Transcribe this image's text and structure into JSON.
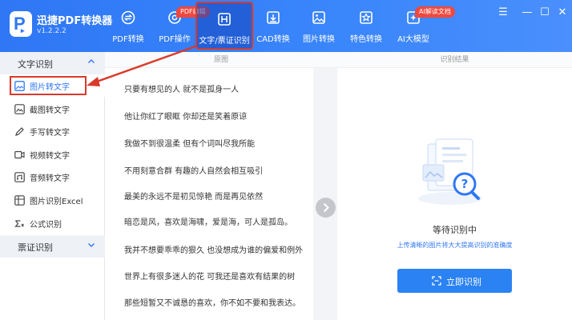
{
  "app": {
    "name": "迅捷PDF转换器",
    "version": "v1.2.2.2"
  },
  "nav": [
    {
      "label": "PDF转换"
    },
    {
      "label": "PDF操作",
      "tag": "PDF编辑"
    },
    {
      "label": "文字/票证识别"
    },
    {
      "label": "CAD转换"
    },
    {
      "label": "图片转换"
    },
    {
      "label": "特色转换"
    },
    {
      "label": "AI大模型",
      "tag": "AI解读文档"
    }
  ],
  "window_controls": {
    "menu": "☰",
    "minimize": "—",
    "maximize": "☐",
    "close": "✕"
  },
  "sidebar": {
    "section1": "文字识别",
    "items": [
      {
        "label": "图片转文字"
      },
      {
        "label": "截图转文字"
      },
      {
        "label": "手写转文字"
      },
      {
        "label": "视频转文字"
      },
      {
        "label": "音频转文字"
      },
      {
        "label": "图片识别Excel"
      },
      {
        "label": "公式识别"
      }
    ],
    "section2": "票证识别"
  },
  "columns": {
    "original": "原图",
    "result": "识别结果"
  },
  "original_text": [
    "只要有想见的人 就不是孤身一人",
    "他让你红了眼眶 你却还是笑着原谅",
    "我做不到很温柔 但有个词叫尽我所能",
    "不用刻意合群 有趣的人自然会相互吸引",
    "最美的永远不是初见惊艳 而是再见依然",
    "暗恋是风，喜欢是海啸，爱是海，可人是孤岛。",
    "我并不想要乖乖的狠久 也没想成为谁的偏爱和例外",
    "世界上有很多迷人的花 可我还是喜欢有结果的树",
    "那些短暂又不诚恳的喜欢，你不如不要和我表达。"
  ],
  "result": {
    "status": "等待识别中",
    "hint": "上传清晰的图片将大大提高识别的准确度",
    "button": "立即识别"
  },
  "colors": {
    "brand": "#2f77f5",
    "highlight": "#d93a2b",
    "tag": "#f0483e"
  }
}
